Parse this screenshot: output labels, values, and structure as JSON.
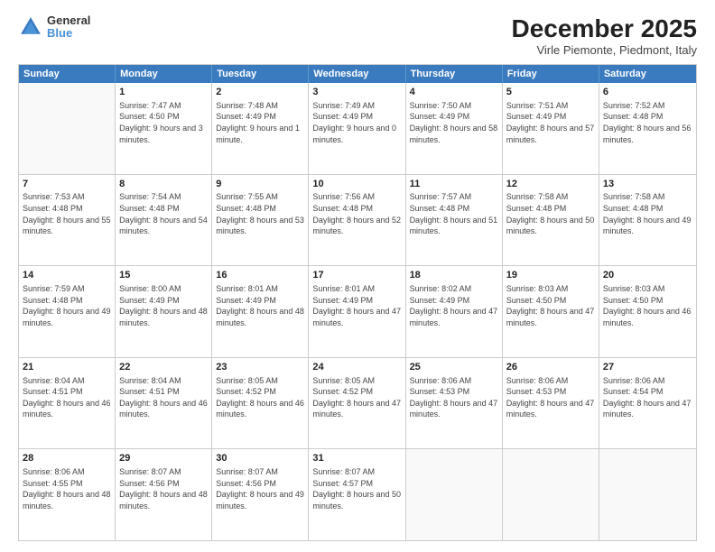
{
  "header": {
    "logo_line1": "General",
    "logo_line2": "Blue",
    "title": "December 2025",
    "subtitle": "Virle Piemonte, Piedmont, Italy"
  },
  "days_of_week": [
    "Sunday",
    "Monday",
    "Tuesday",
    "Wednesday",
    "Thursday",
    "Friday",
    "Saturday"
  ],
  "weeks": [
    [
      {
        "day": "",
        "sunrise": "",
        "sunset": "",
        "daylight": "",
        "empty": true
      },
      {
        "day": "1",
        "sunrise": "Sunrise: 7:47 AM",
        "sunset": "Sunset: 4:50 PM",
        "daylight": "Daylight: 9 hours and 3 minutes."
      },
      {
        "day": "2",
        "sunrise": "Sunrise: 7:48 AM",
        "sunset": "Sunset: 4:49 PM",
        "daylight": "Daylight: 9 hours and 1 minute."
      },
      {
        "day": "3",
        "sunrise": "Sunrise: 7:49 AM",
        "sunset": "Sunset: 4:49 PM",
        "daylight": "Daylight: 9 hours and 0 minutes."
      },
      {
        "day": "4",
        "sunrise": "Sunrise: 7:50 AM",
        "sunset": "Sunset: 4:49 PM",
        "daylight": "Daylight: 8 hours and 58 minutes."
      },
      {
        "day": "5",
        "sunrise": "Sunrise: 7:51 AM",
        "sunset": "Sunset: 4:49 PM",
        "daylight": "Daylight: 8 hours and 57 minutes."
      },
      {
        "day": "6",
        "sunrise": "Sunrise: 7:52 AM",
        "sunset": "Sunset: 4:48 PM",
        "daylight": "Daylight: 8 hours and 56 minutes."
      }
    ],
    [
      {
        "day": "7",
        "sunrise": "Sunrise: 7:53 AM",
        "sunset": "Sunset: 4:48 PM",
        "daylight": "Daylight: 8 hours and 55 minutes."
      },
      {
        "day": "8",
        "sunrise": "Sunrise: 7:54 AM",
        "sunset": "Sunset: 4:48 PM",
        "daylight": "Daylight: 8 hours and 54 minutes."
      },
      {
        "day": "9",
        "sunrise": "Sunrise: 7:55 AM",
        "sunset": "Sunset: 4:48 PM",
        "daylight": "Daylight: 8 hours and 53 minutes."
      },
      {
        "day": "10",
        "sunrise": "Sunrise: 7:56 AM",
        "sunset": "Sunset: 4:48 PM",
        "daylight": "Daylight: 8 hours and 52 minutes."
      },
      {
        "day": "11",
        "sunrise": "Sunrise: 7:57 AM",
        "sunset": "Sunset: 4:48 PM",
        "daylight": "Daylight: 8 hours and 51 minutes."
      },
      {
        "day": "12",
        "sunrise": "Sunrise: 7:58 AM",
        "sunset": "Sunset: 4:48 PM",
        "daylight": "Daylight: 8 hours and 50 minutes."
      },
      {
        "day": "13",
        "sunrise": "Sunrise: 7:58 AM",
        "sunset": "Sunset: 4:48 PM",
        "daylight": "Daylight: 8 hours and 49 minutes."
      }
    ],
    [
      {
        "day": "14",
        "sunrise": "Sunrise: 7:59 AM",
        "sunset": "Sunset: 4:48 PM",
        "daylight": "Daylight: 8 hours and 49 minutes."
      },
      {
        "day": "15",
        "sunrise": "Sunrise: 8:00 AM",
        "sunset": "Sunset: 4:49 PM",
        "daylight": "Daylight: 8 hours and 48 minutes."
      },
      {
        "day": "16",
        "sunrise": "Sunrise: 8:01 AM",
        "sunset": "Sunset: 4:49 PM",
        "daylight": "Daylight: 8 hours and 48 minutes."
      },
      {
        "day": "17",
        "sunrise": "Sunrise: 8:01 AM",
        "sunset": "Sunset: 4:49 PM",
        "daylight": "Daylight: 8 hours and 47 minutes."
      },
      {
        "day": "18",
        "sunrise": "Sunrise: 8:02 AM",
        "sunset": "Sunset: 4:49 PM",
        "daylight": "Daylight: 8 hours and 47 minutes."
      },
      {
        "day": "19",
        "sunrise": "Sunrise: 8:03 AM",
        "sunset": "Sunset: 4:50 PM",
        "daylight": "Daylight: 8 hours and 47 minutes."
      },
      {
        "day": "20",
        "sunrise": "Sunrise: 8:03 AM",
        "sunset": "Sunset: 4:50 PM",
        "daylight": "Daylight: 8 hours and 46 minutes."
      }
    ],
    [
      {
        "day": "21",
        "sunrise": "Sunrise: 8:04 AM",
        "sunset": "Sunset: 4:51 PM",
        "daylight": "Daylight: 8 hours and 46 minutes."
      },
      {
        "day": "22",
        "sunrise": "Sunrise: 8:04 AM",
        "sunset": "Sunset: 4:51 PM",
        "daylight": "Daylight: 8 hours and 46 minutes."
      },
      {
        "day": "23",
        "sunrise": "Sunrise: 8:05 AM",
        "sunset": "Sunset: 4:52 PM",
        "daylight": "Daylight: 8 hours and 46 minutes."
      },
      {
        "day": "24",
        "sunrise": "Sunrise: 8:05 AM",
        "sunset": "Sunset: 4:52 PM",
        "daylight": "Daylight: 8 hours and 47 minutes."
      },
      {
        "day": "25",
        "sunrise": "Sunrise: 8:06 AM",
        "sunset": "Sunset: 4:53 PM",
        "daylight": "Daylight: 8 hours and 47 minutes."
      },
      {
        "day": "26",
        "sunrise": "Sunrise: 8:06 AM",
        "sunset": "Sunset: 4:53 PM",
        "daylight": "Daylight: 8 hours and 47 minutes."
      },
      {
        "day": "27",
        "sunrise": "Sunrise: 8:06 AM",
        "sunset": "Sunset: 4:54 PM",
        "daylight": "Daylight: 8 hours and 47 minutes."
      }
    ],
    [
      {
        "day": "28",
        "sunrise": "Sunrise: 8:06 AM",
        "sunset": "Sunset: 4:55 PM",
        "daylight": "Daylight: 8 hours and 48 minutes."
      },
      {
        "day": "29",
        "sunrise": "Sunrise: 8:07 AM",
        "sunset": "Sunset: 4:56 PM",
        "daylight": "Daylight: 8 hours and 48 minutes."
      },
      {
        "day": "30",
        "sunrise": "Sunrise: 8:07 AM",
        "sunset": "Sunset: 4:56 PM",
        "daylight": "Daylight: 8 hours and 49 minutes."
      },
      {
        "day": "31",
        "sunrise": "Sunrise: 8:07 AM",
        "sunset": "Sunset: 4:57 PM",
        "daylight": "Daylight: 8 hours and 50 minutes."
      },
      {
        "day": "",
        "sunrise": "",
        "sunset": "",
        "daylight": "",
        "empty": true
      },
      {
        "day": "",
        "sunrise": "",
        "sunset": "",
        "daylight": "",
        "empty": true
      },
      {
        "day": "",
        "sunrise": "",
        "sunset": "",
        "daylight": "",
        "empty": true
      }
    ]
  ]
}
